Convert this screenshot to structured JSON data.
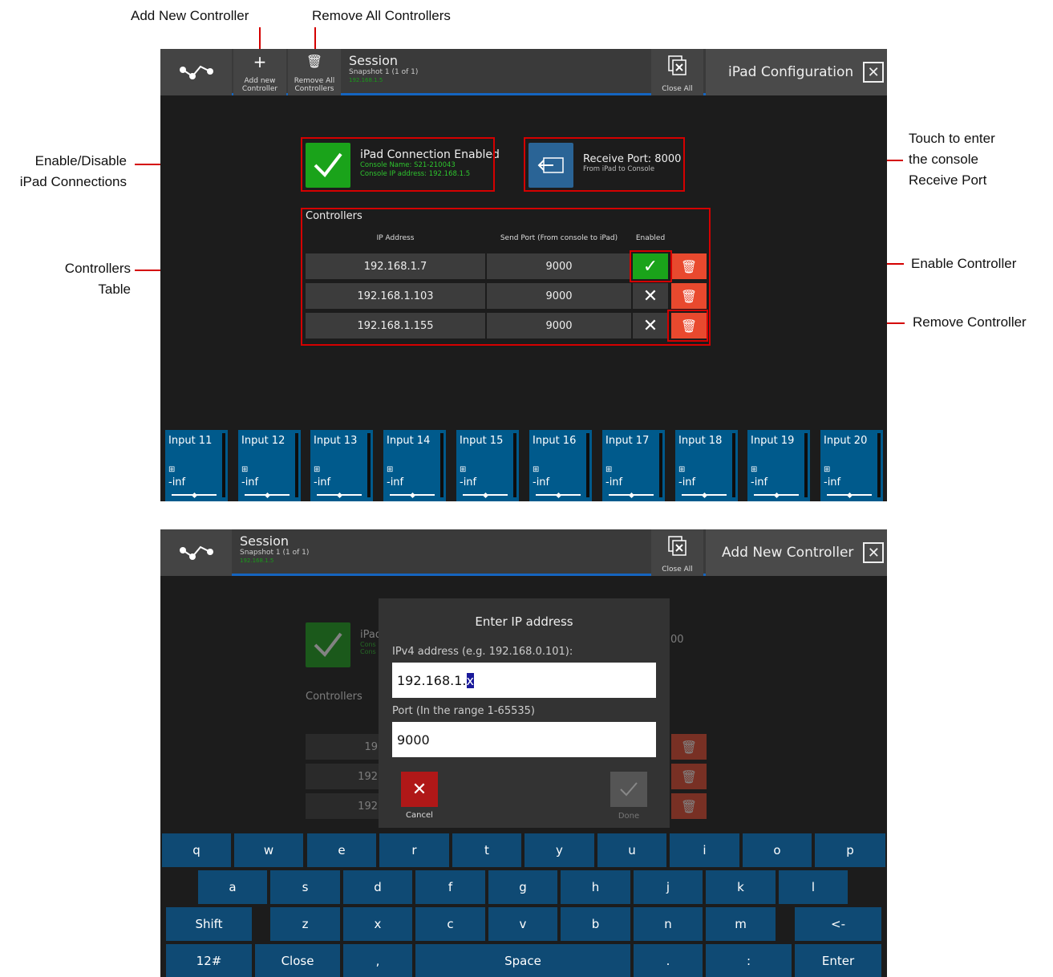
{
  "callouts": {
    "add_new_controller": "Add New Controller",
    "remove_all_controllers": "Remove All Controllers",
    "enable_disable_1": "Enable/Disable",
    "enable_disable_2": "iPad Connections",
    "controllers_table_1": "Controllers",
    "controllers_table_2": "Table",
    "touch_port_1": "Touch to enter",
    "touch_port_2": "the console",
    "touch_port_3": "Receive Port",
    "enable_controller": "Enable Controller",
    "remove_controller": "Remove Controller"
  },
  "top_screen": {
    "toolbar": {
      "add_label_1": "Add new",
      "add_label_2": "Controller",
      "remove_label_1": "Remove All",
      "remove_label_2": "Controllers",
      "close_all": "Close All"
    },
    "session": {
      "title": "Session",
      "snapshot": "Snapshot 1 (1 of 1)",
      "ip": "192.168.1.5"
    },
    "panel_title": "iPad Configuration",
    "connection": {
      "title": "iPad Connection Enabled",
      "console_name": "Console Name: S21-210043",
      "console_ip": "Console IP address: 192.168.1.5"
    },
    "receive_port": {
      "title": "Receive Port: 8000",
      "subtitle": "From iPad to Console"
    },
    "controllers": {
      "heading": "Controllers",
      "columns": {
        "ip": "IP Address",
        "port": "Send Port (From console to iPad)",
        "enabled": "Enabled"
      },
      "rows": [
        {
          "ip": "192.168.1.7",
          "port": "9000",
          "enabled": true
        },
        {
          "ip": "192.168.1.103",
          "port": "9000",
          "enabled": false
        },
        {
          "ip": "192.168.1.155",
          "port": "9000",
          "enabled": false
        }
      ]
    },
    "channels": [
      {
        "name": "Input 11",
        "level": "-inf"
      },
      {
        "name": "Input 12",
        "level": "-inf"
      },
      {
        "name": "Input 13",
        "level": "-inf"
      },
      {
        "name": "Input 14",
        "level": "-inf"
      },
      {
        "name": "Input 15",
        "level": "-inf"
      },
      {
        "name": "Input 16",
        "level": "-inf"
      },
      {
        "name": "Input 17",
        "level": "-inf"
      },
      {
        "name": "Input 18",
        "level": "-inf"
      },
      {
        "name": "Input 19",
        "level": "-inf"
      },
      {
        "name": "Input 20",
        "level": "-inf"
      }
    ]
  },
  "bottom_screen": {
    "session": {
      "title": "Session",
      "snapshot": "Snapshot 1 (1 of 1)",
      "ip": "192.168.1.5"
    },
    "close_all": "Close All",
    "panel_title": "Add New Controller",
    "background": {
      "partial_title": "iPad",
      "partial_green_1": "Cons",
      "partial_green_2": "Cons",
      "controllers": "Controllers",
      "row1": "19",
      "row2": "192",
      "row3": "192",
      "port_fragment": "00"
    },
    "dialog": {
      "title": "Enter IP address",
      "ip_label": "IPv4 address (e.g. 192.168.0.101):",
      "ip_prefix": "192.168.1.",
      "ip_selected": "x",
      "port_label": "Port (In the range 1-65535)",
      "port_value": "9000",
      "cancel": "Cancel",
      "done": "Done"
    },
    "keyboard": {
      "row1": [
        "q",
        "w",
        "e",
        "r",
        "t",
        "y",
        "u",
        "i",
        "o",
        "p"
      ],
      "row2": [
        "a",
        "s",
        "d",
        "f",
        "g",
        "h",
        "j",
        "k",
        "l"
      ],
      "shift": "Shift",
      "row3": [
        "z",
        "x",
        "c",
        "v",
        "b",
        "n",
        "m"
      ],
      "backspace": "<-",
      "k12": "12#",
      "close": "Close",
      "comma": ",",
      "space": "Space",
      "period": ".",
      "colon": ":",
      "enter": "Enter"
    }
  }
}
